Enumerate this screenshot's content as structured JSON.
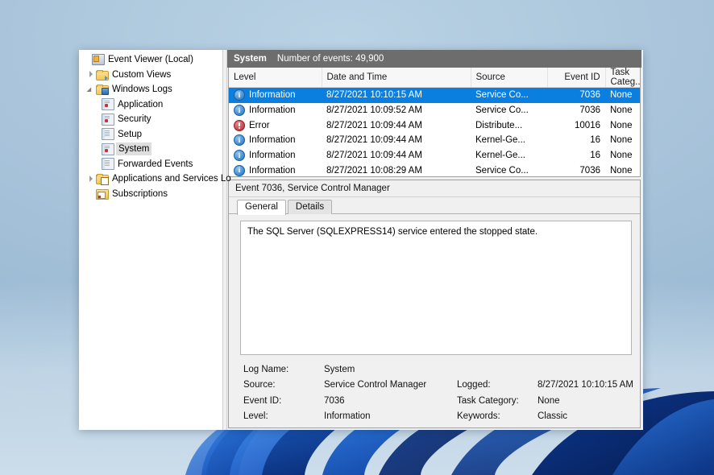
{
  "window": {
    "tree": {
      "items": [
        {
          "label": "Event Viewer (Local)",
          "icon": "computer-icon",
          "indent": 1,
          "expander": "none",
          "selected": false
        },
        {
          "label": "Custom Views",
          "icon": "folder-arrow-icon",
          "indent": 2,
          "expander": "closed",
          "selected": false
        },
        {
          "label": "Windows Logs",
          "icon": "folder-blue-icon",
          "indent": 2,
          "expander": "open",
          "selected": false
        },
        {
          "label": "Application",
          "icon": "log-red-icon",
          "indent": 3,
          "expander": "none",
          "selected": false
        },
        {
          "label": "Security",
          "icon": "log-red-icon",
          "indent": 3,
          "expander": "none",
          "selected": false
        },
        {
          "label": "Setup",
          "icon": "log-plain-icon",
          "indent": 3,
          "expander": "none",
          "selected": false
        },
        {
          "label": "System",
          "icon": "log-red-icon",
          "indent": 3,
          "expander": "none",
          "selected": true
        },
        {
          "label": "Forwarded Events",
          "icon": "log-plain-icon",
          "indent": 3,
          "expander": "none",
          "selected": false
        },
        {
          "label": "Applications and Services Lo",
          "icon": "folder-cal-icon",
          "indent": 2,
          "expander": "closed",
          "selected": false
        },
        {
          "label": "Subscriptions",
          "icon": "subscriptions-icon",
          "indent": 2,
          "expander": "none",
          "selected": false
        }
      ]
    },
    "pane_header": {
      "title": "System",
      "count": "Number of events: 49,900"
    },
    "event_list": {
      "columns": [
        "Level",
        "Date and Time",
        "Source",
        "Event ID",
        "Task Categ..."
      ],
      "rows": [
        {
          "level": "Information",
          "level_icon": "info-icon",
          "datetime": "8/27/2021 10:10:15 AM",
          "source": "Service Co...",
          "event_id": "7036",
          "task": "None",
          "selected": true
        },
        {
          "level": "Information",
          "level_icon": "info-icon",
          "datetime": "8/27/2021 10:09:52 AM",
          "source": "Service Co...",
          "event_id": "7036",
          "task": "None",
          "selected": false
        },
        {
          "level": "Error",
          "level_icon": "error-icon",
          "datetime": "8/27/2021 10:09:44 AM",
          "source": "Distribute...",
          "event_id": "10016",
          "task": "None",
          "selected": false
        },
        {
          "level": "Information",
          "level_icon": "info-icon",
          "datetime": "8/27/2021 10:09:44 AM",
          "source": "Kernel-Ge...",
          "event_id": "16",
          "task": "None",
          "selected": false
        },
        {
          "level": "Information",
          "level_icon": "info-icon",
          "datetime": "8/27/2021 10:09:44 AM",
          "source": "Kernel-Ge...",
          "event_id": "16",
          "task": "None",
          "selected": false
        },
        {
          "level": "Information",
          "level_icon": "info-icon",
          "datetime": "8/27/2021 10:08:29 AM",
          "source": "Service Co...",
          "event_id": "7036",
          "task": "None",
          "selected": false
        }
      ]
    },
    "detail": {
      "title": "Event 7036, Service Control Manager",
      "tabs": [
        {
          "label": "General",
          "active": true
        },
        {
          "label": "Details",
          "active": false
        }
      ],
      "description": "The SQL Server (SQLEXPRESS14) service entered the stopped state.",
      "properties": [
        {
          "k1": "Log Name:",
          "v1": "System",
          "k2": "",
          "v2": ""
        },
        {
          "k1": "Source:",
          "v1": "Service Control Manager",
          "k2": "Logged:",
          "v2": "8/27/2021 10:10:15 AM"
        },
        {
          "k1": "Event ID:",
          "v1": "7036",
          "k2": "Task Category:",
          "v2": "None"
        },
        {
          "k1": "Level:",
          "v1": "Information",
          "k2": "Keywords:",
          "v2": "Classic"
        }
      ]
    }
  },
  "colors": {
    "selection": "#0a7fe0",
    "pane_header_bg": "#6d6d6d",
    "error": "#b3262f",
    "info": "#1b6fc0"
  }
}
